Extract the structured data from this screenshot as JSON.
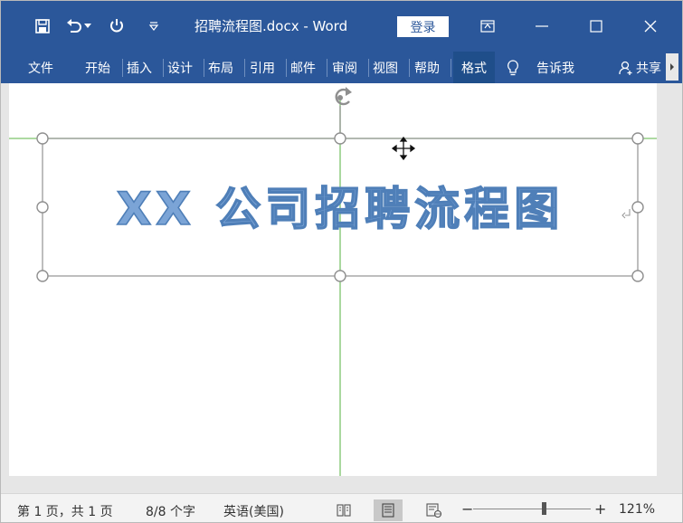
{
  "titlebar": {
    "doc_title": "招聘流程图.docx - Word",
    "login_label": "登录"
  },
  "ribbon": {
    "tabs": [
      {
        "label": "文件"
      },
      {
        "label": "开始"
      },
      {
        "label": "插入"
      },
      {
        "label": "设计"
      },
      {
        "label": "布局"
      },
      {
        "label": "引用"
      },
      {
        "label": "邮件"
      },
      {
        "label": "审阅"
      },
      {
        "label": "视图"
      },
      {
        "label": "帮助"
      },
      {
        "label": "格式"
      }
    ],
    "tell_me": "告诉我",
    "share": "共享"
  },
  "document": {
    "wordart_text": "XX 公司招聘流程图",
    "wordart_fill": "#7ba4d6",
    "wordart_outline": "#4f7fb8"
  },
  "statusbar": {
    "page_info": "第 1 页，共 1 页",
    "word_count": "8/8 个字",
    "language": "英语(美国)",
    "zoom_minus": "−",
    "zoom_plus": "+",
    "zoom_level": "121%",
    "zoom_fraction": 0.6
  },
  "colors": {
    "word_blue": "#2b579a",
    "guide_green": "#7dc36b",
    "handle_gray": "#8f8f8f"
  }
}
